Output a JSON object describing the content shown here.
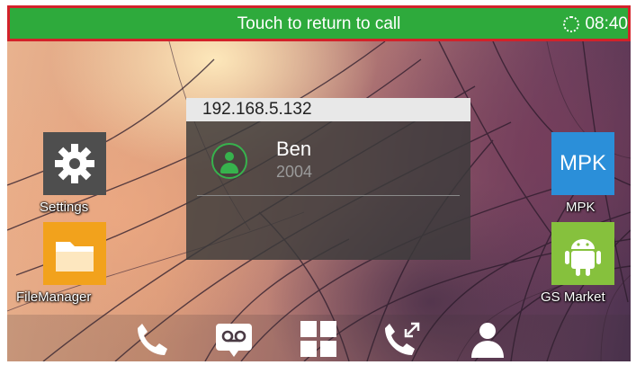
{
  "status_bar": {
    "message": "Touch to return to call",
    "time": "08:40"
  },
  "call_popup": {
    "ip_address": "192.168.5.132",
    "contact_name": "Ben",
    "contact_number": "2004"
  },
  "apps": {
    "left": [
      {
        "label": "Settings",
        "icon": "gear-icon"
      },
      {
        "label": "FileManager",
        "icon": "folder-icon"
      }
    ],
    "right": [
      {
        "label": "MPK",
        "tile_text": "MPK",
        "icon": "mpk-icon"
      },
      {
        "label": "GS Market",
        "icon": "android-icon"
      }
    ]
  },
  "dock": [
    {
      "icon": "phone-icon"
    },
    {
      "icon": "voicemail-icon"
    },
    {
      "icon": "apps-grid-icon"
    },
    {
      "icon": "call-transfer-icon"
    },
    {
      "icon": "contacts-icon"
    }
  ],
  "colors": {
    "status_bar_green": "#2eaa3c",
    "status_bar_border": "#d3222a",
    "avatar_green": "#37b24d",
    "mpk_blue": "#2b8fd9",
    "market_green": "#86c13d",
    "files_orange": "#f2a21c"
  }
}
